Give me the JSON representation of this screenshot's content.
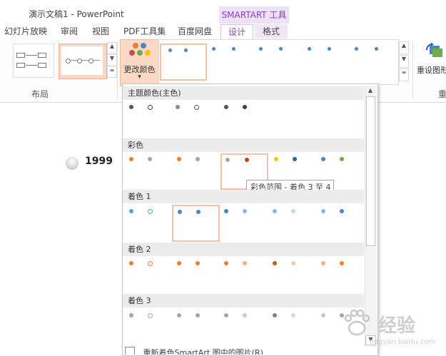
{
  "window": {
    "title": "演示文稿1 - PowerPoint"
  },
  "contextual_tab": {
    "label": "SMARTART 工具"
  },
  "tabs": [
    {
      "label": "幻灯片放映"
    },
    {
      "label": "审阅"
    },
    {
      "label": "视图"
    },
    {
      "label": "PDF工具集"
    },
    {
      "label": "百度网盘"
    },
    {
      "label": "设计"
    },
    {
      "label": "格式"
    }
  ],
  "ribbon": {
    "layout_group_label": "布局",
    "change_colors_label": "更改颜色",
    "change_colors_arrow": "▾",
    "reset_label": "重设图形",
    "reset_group_label": "重"
  },
  "slide": {
    "year": "1999"
  },
  "color_dropdown": {
    "sections": [
      {
        "label": "主题颜色(主色)"
      },
      {
        "label": "彩色"
      },
      {
        "label": "着色 1"
      },
      {
        "label": "着色 2"
      },
      {
        "label": "着色 3"
      }
    ],
    "tooltip": "彩色范围 - 着色 3 至 4",
    "footer": "重新着色SmartArt 图中的图片(R)"
  },
  "watermark": {
    "text": "经验",
    "subtext": "jingyan.baidu.com"
  },
  "colors": {
    "accent_purple": "#8b3fb5",
    "selection": "#f5c1a6",
    "orange": "#ed7d31",
    "blue": "#4a86c8",
    "green": "#70ad47",
    "gold": "#ffc000"
  }
}
